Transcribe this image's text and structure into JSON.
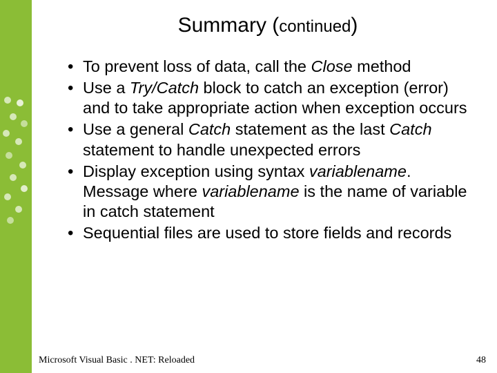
{
  "title": {
    "main": "Summary ",
    "paren_open": "(",
    "continued": "continued",
    "paren_close": ")"
  },
  "bullets": {
    "b1": {
      "pre": "To prevent loss of data, call the ",
      "kw": "Close",
      "post": " method"
    },
    "b2": {
      "pre": "Use a ",
      "kw": "Try/Catch",
      "post": " block to catch an exception (error) and to take appropriate action when exception occurs"
    },
    "b3": {
      "pre": "Use a general ",
      "kw1": "Catch",
      "mid": " statement as the last ",
      "kw2": "Catch",
      "post": " statement to handle unexpected errors"
    },
    "b4": {
      "pre": "Display exception using syntax ",
      "kw1": "variablename",
      "dot": ". ",
      "msg": "Message",
      "mid": " where ",
      "kw2": "variablename",
      "post": " is the name of variable in catch statement"
    },
    "b5": {
      "text": "Sequential files are used to store fields and records"
    }
  },
  "footer": {
    "left": "Microsoft Visual Basic . NET: Reloaded",
    "page": "48"
  }
}
